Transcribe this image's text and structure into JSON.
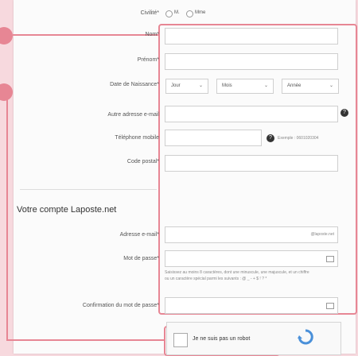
{
  "form": {
    "civility": {
      "label": "Civilité*",
      "options": [
        "M.",
        "Mme"
      ]
    },
    "name": {
      "label": "Nom*"
    },
    "first_name": {
      "label": "Prénom*"
    },
    "birth_date": {
      "label": "Date de Naissance*",
      "day": "Jour",
      "month": "Mois",
      "year": "Année"
    },
    "other_email": {
      "label": "Autre adresse e-mail"
    },
    "mobile": {
      "label": "Téléphone mobile",
      "example": "Exemple : 0601020304"
    },
    "postal_code": {
      "label": "Code postal*"
    }
  },
  "account": {
    "title": "Votre compte Laposte.net",
    "email": {
      "label": "Adresse e-mail*",
      "suffix": "@laposte.net"
    },
    "password": {
      "label": "Mot de passe*",
      "hint_line1": "Saisissez au moins 8 caractères, dont une minuscule, une majuscule, et un chiffre",
      "hint_line2": "ou un caractère spécial parmi les suivants : @ _ - + $ ! ? *"
    },
    "password_confirm": {
      "label": "Confirmation du mot de passe*"
    }
  },
  "captcha": {
    "label": "Je ne suis pas un robot"
  },
  "colors": {
    "highlight": "#e78694",
    "background": "#f7d9de"
  }
}
